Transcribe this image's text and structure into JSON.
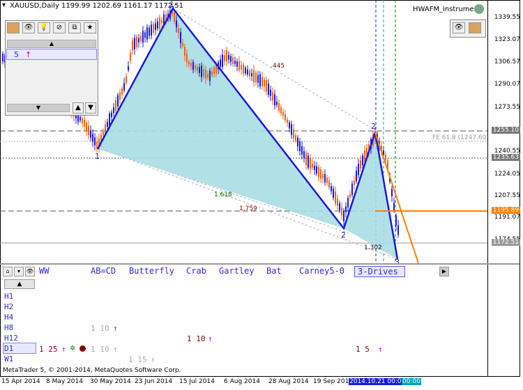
{
  "chart": {
    "symbol_line": "XAUUSD,Daily  1199.99 1202.69 1161.17 1172.51",
    "indicator_name": "HWAFM_instrument",
    "price_labels": [
      "1339.55",
      "1323.07",
      "1306.57",
      "1290.07",
      "1273.55",
      "1255.10",
      "1240.55",
      "1235.63",
      "1224.05",
      "1207.55",
      "1195.89",
      "1191.07",
      "1174.55",
      "1172.51"
    ],
    "date_labels": [
      "15 Apr 2014",
      "8 May 2014",
      "30 May 2014",
      "23 Jun 2014",
      "15 Jul 2014",
      "6 Aug 2014",
      "28 Aug 2014",
      "19 Sep 2014",
      "2014.10.21 00:00",
      "00:00"
    ],
    "annotations": {
      "pt1_top": "1-",
      "pt1": "1",
      "pt2_top": "2",
      "pt2": "2",
      "pt3": "3",
      "r445": ".445",
      "r1618": "1.618",
      "r1759": "1.759",
      "r1302": "1.302",
      "fe": "FE 61.8 (1247.60)"
    },
    "colors": {
      "fill": "#a8dde4",
      "pattern_line": "#1a1ad8",
      "projection": "#ff8000",
      "bull_candle": "#1a1ad8",
      "bear_candle": "#e8651a"
    }
  },
  "toolbar_panel": {
    "value": "5",
    "arrow": "↑"
  },
  "bottom_panel": {
    "tabs": [
      "WW",
      "AB=CD",
      "Butterfly",
      "Crab",
      "Gartley",
      "Bat",
      "Carney5-0",
      "3-Drives"
    ],
    "active_tab": "3-Drives",
    "timeframes": [
      "H1",
      "H2",
      "H4",
      "H8",
      "H12",
      "D1",
      "W1"
    ],
    "rows": {
      "h8_a": "1 10",
      "h12_a": "1 10",
      "d1_a": "1 25",
      "d1_b": "1 10",
      "d1_c": "1 5",
      "w1_a": "1 15"
    },
    "arrow_up": "↑",
    "copyright": "MetaTrader 5, © 2001-2014, MetaQuotes Software Corp."
  }
}
